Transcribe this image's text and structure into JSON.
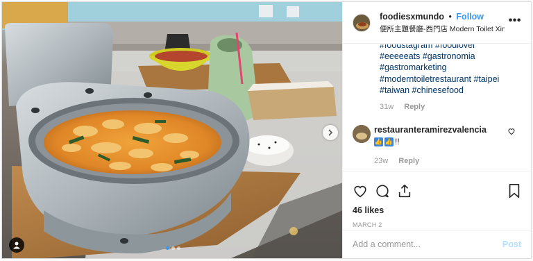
{
  "post": {
    "photo_alt": "Curry dish served in a toilet-shaped bowl",
    "carousel": {
      "count": 3,
      "active_index": 0
    },
    "icons": {
      "next": "chevron-right-icon",
      "tag": "user-tag-icon"
    }
  },
  "header": {
    "username": "foodiesxmundo",
    "separator": "•",
    "follow_label": "Follow",
    "location": "便所主題餐廳-西門店 Modern Toilet Ximen",
    "more_label": "•••"
  },
  "caption": {
    "hashtags": [
      "#foodstagram #foodlover",
      "#eeeeeats #gastronomia",
      "#gastromarketing",
      "#moderntoiletrestaurant #taipei",
      "#taiwan #chinesefood"
    ],
    "time": "31w",
    "reply_label": "Reply"
  },
  "comment": {
    "username": "restauranteramirezvalencia",
    "text": "!!",
    "time": "23w",
    "reply_label": "Reply",
    "icons": {
      "emoji": "thumbs-up-emoji-icon",
      "like": "heart-icon"
    }
  },
  "actions": {
    "icons": [
      "heart-icon",
      "comment-icon",
      "share-icon",
      "bookmark-icon"
    ],
    "likes": "46 likes",
    "date": "MARCH 2"
  },
  "add_comment": {
    "placeholder": "Add a comment...",
    "post_label": "Post"
  },
  "colors": {
    "link_blue": "#3897f0",
    "hashtag": "#003569",
    "muted": "#999999",
    "post_disabled": "#b2dffc"
  }
}
